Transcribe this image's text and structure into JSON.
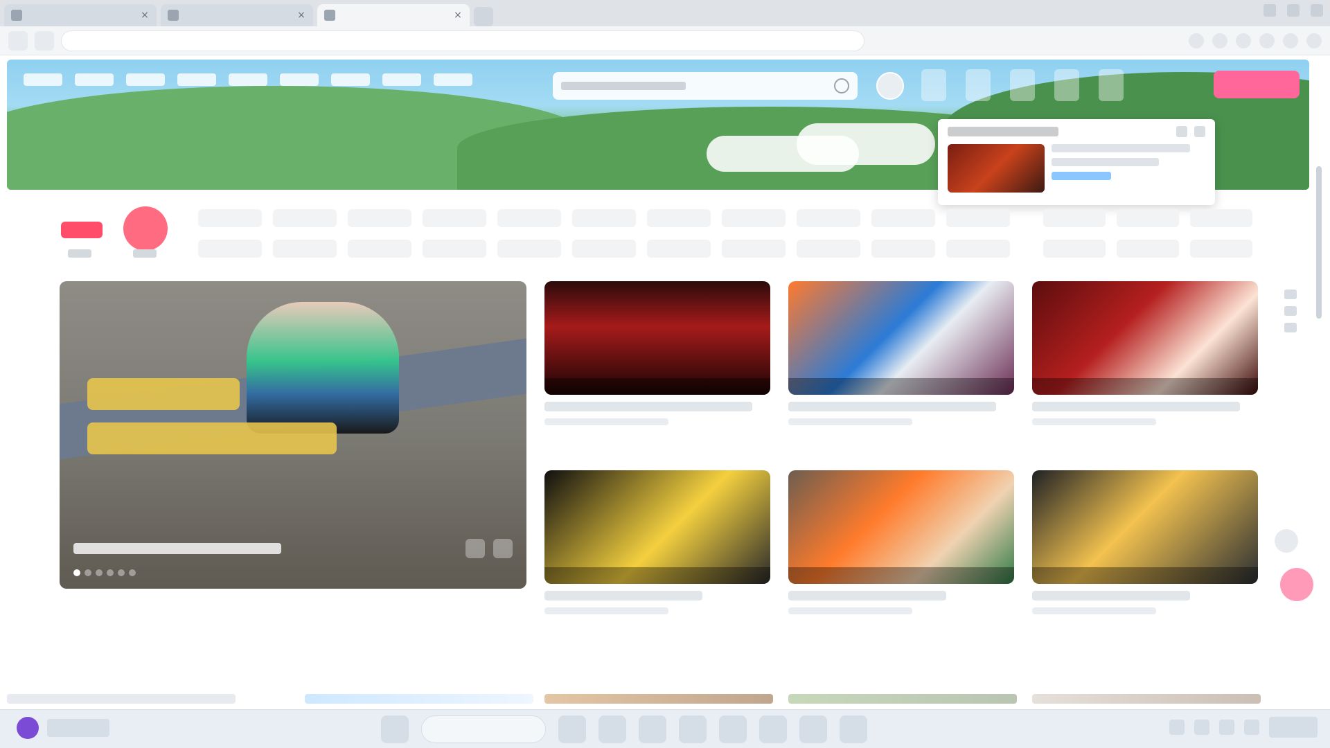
{
  "browser": {
    "tabs": [
      {
        "title": "",
        "active": false
      },
      {
        "title": "",
        "active": false
      },
      {
        "title": "",
        "active": true
      }
    ],
    "address": {
      "url": ""
    },
    "toolbar": {
      "search_text": ""
    }
  },
  "site": {
    "top_nav": [],
    "search": {
      "placeholder": ""
    },
    "upload_label": "",
    "popup": {
      "title": "",
      "item_title": "",
      "item_meta": ""
    },
    "categories": {
      "row1": [],
      "row2": []
    },
    "feature": {
      "title": ""
    },
    "videos": [
      {
        "title": "",
        "meta": ""
      },
      {
        "title": "",
        "meta": ""
      },
      {
        "title": "",
        "meta": ""
      },
      {
        "title": "",
        "meta": ""
      },
      {
        "title": "",
        "meta": ""
      },
      {
        "title": "",
        "meta": ""
      }
    ]
  },
  "taskbar": {
    "weather": "",
    "search": "",
    "time": ""
  }
}
